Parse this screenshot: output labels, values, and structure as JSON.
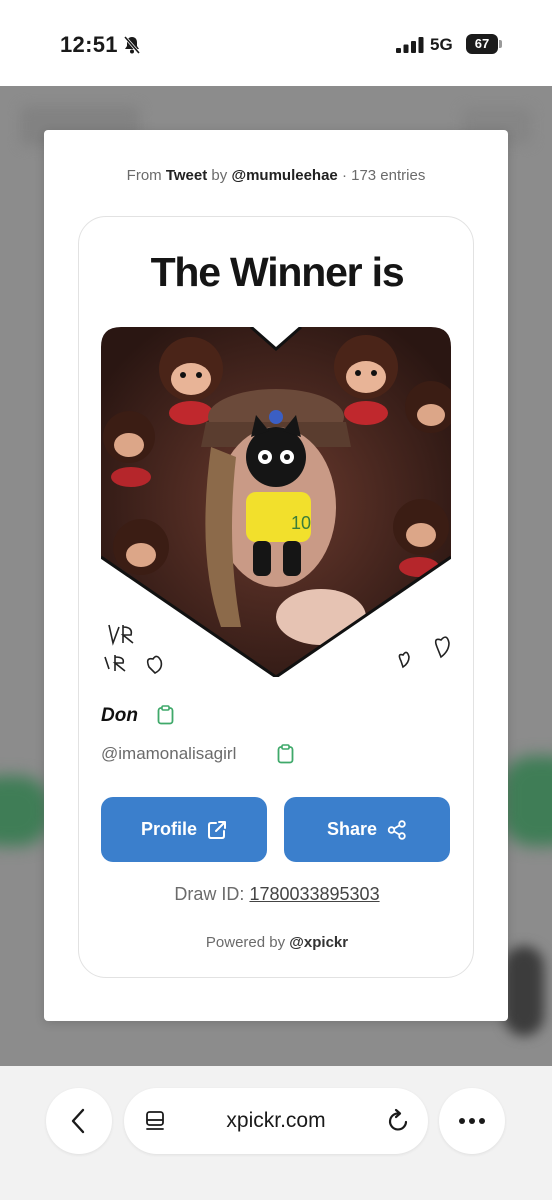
{
  "status": {
    "time": "12:51",
    "network": "5G",
    "battery": "67",
    "icons": [
      "bell-slash-icon",
      "signal-icon"
    ]
  },
  "modal": {
    "source": {
      "prefix": "From",
      "platform": "Tweet",
      "by": "by",
      "user": "@mumuleehae",
      "entries": "· 173 entries"
    },
    "title": "The Winner is",
    "winner": {
      "name": "Don",
      "handle": "@imamonalisagirl"
    },
    "buttons": {
      "profile": "Profile",
      "share": "Share"
    },
    "draw": {
      "label": "Draw ID:",
      "id": "1780033895303"
    },
    "powered": {
      "prefix": "Powered by",
      "brand": "@xpickr"
    }
  },
  "browser": {
    "url": "xpickr.com",
    "icons": [
      "back-arrow-icon",
      "tabs-icon",
      "reload-icon",
      "more-icon"
    ]
  },
  "colors": {
    "accent": "#3b7fcc",
    "copy_green": "#3fa96a",
    "backdrop": "#8c8c8c"
  }
}
